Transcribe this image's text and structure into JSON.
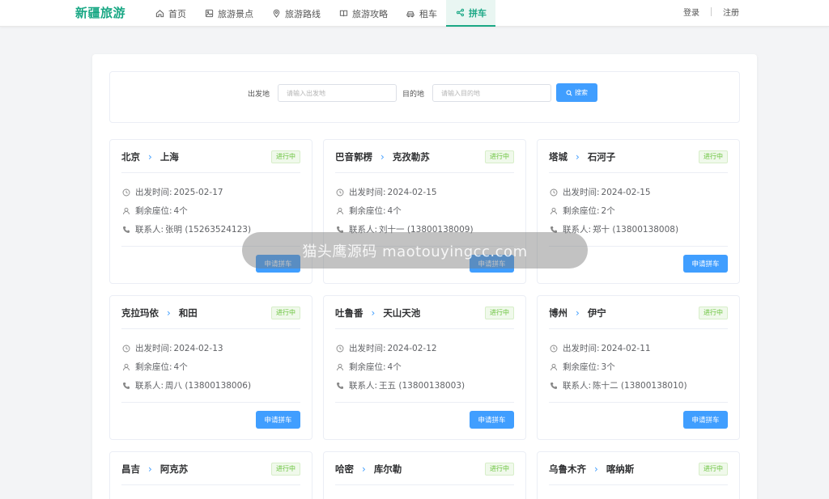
{
  "app": {
    "logo": "新疆旅游"
  },
  "nav": [
    {
      "label": "首页",
      "icon": "home-icon"
    },
    {
      "label": "旅游景点",
      "icon": "image-icon"
    },
    {
      "label": "旅游路线",
      "icon": "location-pin-icon"
    },
    {
      "label": "旅游攻略",
      "icon": "book-icon"
    },
    {
      "label": "租车",
      "icon": "car-icon"
    },
    {
      "label": "拼车",
      "icon": "share-icon",
      "active": true
    }
  ],
  "auth": {
    "login": "登录",
    "register": "注册"
  },
  "search": {
    "from_label": "出发地",
    "from_placeholder": "请输入出发地",
    "to_label": "目的地",
    "to_placeholder": "请输入目的地",
    "button": "搜索"
  },
  "labels": {
    "depart_time": "出发时间:",
    "seats": "剩余座位:",
    "contact": "联系人:",
    "apply": "申请拼车"
  },
  "cards": [
    {
      "from": "北京",
      "to": "上海",
      "status": "进行中",
      "time": "2025-02-17",
      "seats": "4个",
      "contact": "张明 (15263524123)"
    },
    {
      "from": "巴音郭楞",
      "to": "克孜勒苏",
      "status": "进行中",
      "time": "2024-02-15",
      "seats": "4个",
      "contact": "刘十一 (13800138009)"
    },
    {
      "from": "塔城",
      "to": "石河子",
      "status": "进行中",
      "time": "2024-02-15",
      "seats": "2个",
      "contact": "郑十 (13800138008)"
    },
    {
      "from": "克拉玛依",
      "to": "和田",
      "status": "进行中",
      "time": "2024-02-13",
      "seats": "4个",
      "contact": "周八 (13800138006)"
    },
    {
      "from": "吐鲁番",
      "to": "天山天池",
      "status": "进行中",
      "time": "2024-02-12",
      "seats": "4个",
      "contact": "王五 (13800138003)"
    },
    {
      "from": "博州",
      "to": "伊宁",
      "status": "进行中",
      "time": "2024-02-11",
      "seats": "3个",
      "contact": "陈十二 (13800138010)"
    },
    {
      "from": "昌吉",
      "to": "阿克苏",
      "status": "进行中"
    },
    {
      "from": "哈密",
      "to": "库尔勒",
      "status": "进行中"
    },
    {
      "from": "乌鲁木齐",
      "to": "喀纳斯",
      "status": "进行中"
    }
  ],
  "watermark": "猫头鹰源码 maotouyingcc.com",
  "colors": {
    "brand": "#1aa885",
    "primary": "#409eff",
    "success": "#67c23a"
  }
}
